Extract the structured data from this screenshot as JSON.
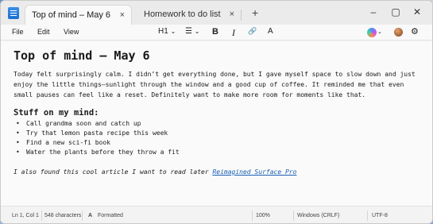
{
  "tabs": [
    {
      "title": "Top of mind – May 6",
      "close": "×"
    },
    {
      "title": "Homework to do list",
      "close": "×"
    }
  ],
  "new_tab": "+",
  "window_controls": {
    "minimize": "–",
    "maximize": "▢",
    "close": "✕"
  },
  "menu": [
    "File",
    "Edit",
    "View"
  ],
  "toolbar": {
    "heading": "H1",
    "heading_chevron": "⌄",
    "list_icon": "☰",
    "bold": "B",
    "italic": "I",
    "link_icon": "🔗",
    "spell_icon": "A"
  },
  "document": {
    "title": "Top of mind – May 6",
    "paragraph": "Today felt surprisingly calm. I didn’t get everything done, but I gave myself space to slow down and just enjoy the little things—sunlight through the window and a good cup of coffee. It reminded me that even small pauses can feel like a reset. Definitely want to make more room for moments like that.",
    "subheading": "Stuff on my mind:",
    "items": [
      "Call grandma soon and catch up",
      "Try that lemon pasta recipe this week",
      "Find a new sci-fi book",
      "Water the plants before they throw a fit"
    ],
    "link_prefix": "I also found this cool article I want to read later ",
    "link_text": "Reimagined Surface Pro"
  },
  "status": {
    "position": "Ln 1, Col 1",
    "characters": "548 characters",
    "format_icon": "A",
    "format": "Formatted",
    "zoom": "100%",
    "line_ending": "Windows (CRLF)",
    "encoding": "UTF-8"
  }
}
